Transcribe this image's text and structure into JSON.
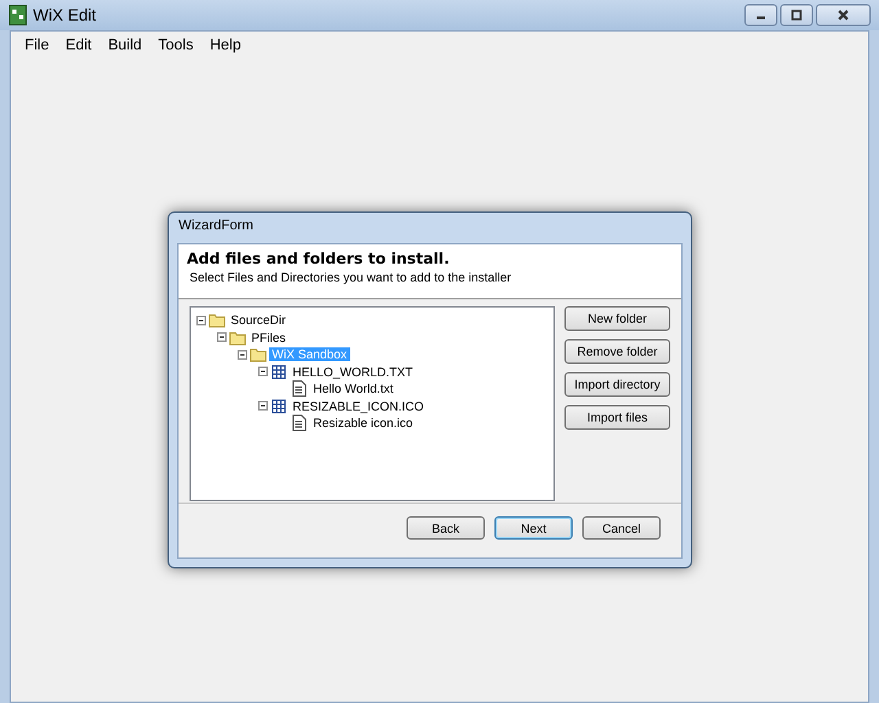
{
  "window": {
    "title": "WiX Edit"
  },
  "menu": [
    {
      "label": "File"
    },
    {
      "label": "Edit"
    },
    {
      "label": "Build"
    },
    {
      "label": "Tools"
    },
    {
      "label": "Help"
    }
  ],
  "dialog": {
    "title": "WizardForm",
    "heading": "Add files and folders to install.",
    "subheading": "Select Files and Directories you want to add to the installer",
    "tree": [
      {
        "label": "SourceDir",
        "kind": "folder",
        "expanded": true,
        "selected": false,
        "children": [
          {
            "label": "PFiles",
            "kind": "folder",
            "expanded": true,
            "selected": false,
            "children": [
              {
                "label": "WiX Sandbox",
                "kind": "folder",
                "expanded": true,
                "selected": true,
                "children": [
                  {
                    "label": "HELLO_WORLD.TXT",
                    "kind": "component",
                    "expanded": true,
                    "selected": false,
                    "children": [
                      {
                        "label": "Hello World.txt",
                        "kind": "file",
                        "selected": false
                      }
                    ]
                  },
                  {
                    "label": "RESIZABLE_ICON.ICO",
                    "kind": "component",
                    "expanded": true,
                    "selected": false,
                    "children": [
                      {
                        "label": "Resizable icon.ico",
                        "kind": "file",
                        "selected": false
                      }
                    ]
                  }
                ]
              }
            ]
          }
        ]
      }
    ],
    "side_buttons": [
      "New folder",
      "Remove folder",
      "Import directory",
      "Import files"
    ],
    "footer_buttons": [
      {
        "label": "Back",
        "default": false
      },
      {
        "label": "Next",
        "default": true
      },
      {
        "label": "Cancel",
        "default": false
      }
    ]
  }
}
